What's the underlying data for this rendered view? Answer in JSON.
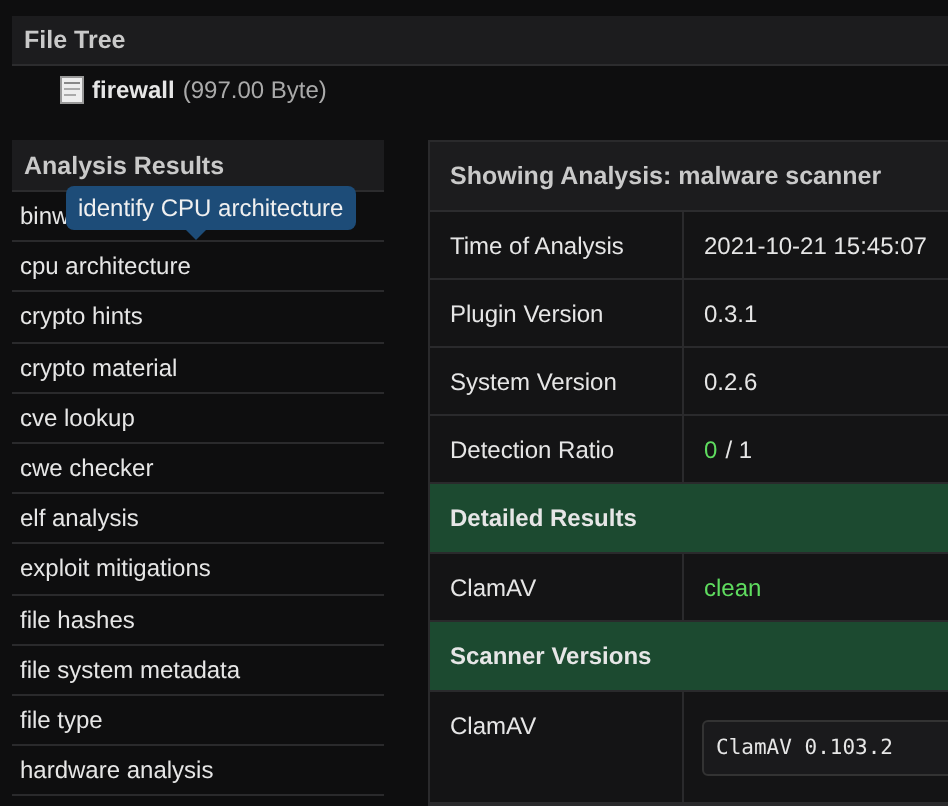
{
  "file_tree": {
    "title": "File Tree",
    "file": {
      "name": "firewall",
      "size": "(997.00 Byte)"
    }
  },
  "analysis_results": {
    "title": "Analysis Results",
    "tooltip": "identify CPU architecture",
    "items": [
      {
        "label": "binw"
      },
      {
        "label": "cpu architecture"
      },
      {
        "label": "crypto hints"
      },
      {
        "label": "crypto material"
      },
      {
        "label": "cve lookup"
      },
      {
        "label": "cwe checker"
      },
      {
        "label": "elf analysis"
      },
      {
        "label": "exploit mitigations"
      },
      {
        "label": "file hashes"
      },
      {
        "label": "file system metadata"
      },
      {
        "label": "file type"
      },
      {
        "label": "hardware analysis"
      }
    ]
  },
  "analysis": {
    "title": "Showing Analysis: malware scanner",
    "rows": [
      {
        "kind": "text",
        "label": "Time of Analysis",
        "value": "2021-10-21 15:45:07"
      },
      {
        "kind": "text",
        "label": "Plugin Version",
        "value": "0.3.1"
      },
      {
        "kind": "text",
        "label": "System Version",
        "value": "0.2.6"
      },
      {
        "kind": "ratio",
        "label": "Detection Ratio",
        "hits": "0",
        "total": "/ 1"
      },
      {
        "kind": "section",
        "label": "Detailed Results"
      },
      {
        "kind": "status",
        "label": "ClamAV",
        "value": "clean"
      },
      {
        "kind": "section",
        "label": "Scanner Versions"
      },
      {
        "kind": "code",
        "label": "ClamAV",
        "value": "ClamAV 0.103.2"
      }
    ]
  }
}
